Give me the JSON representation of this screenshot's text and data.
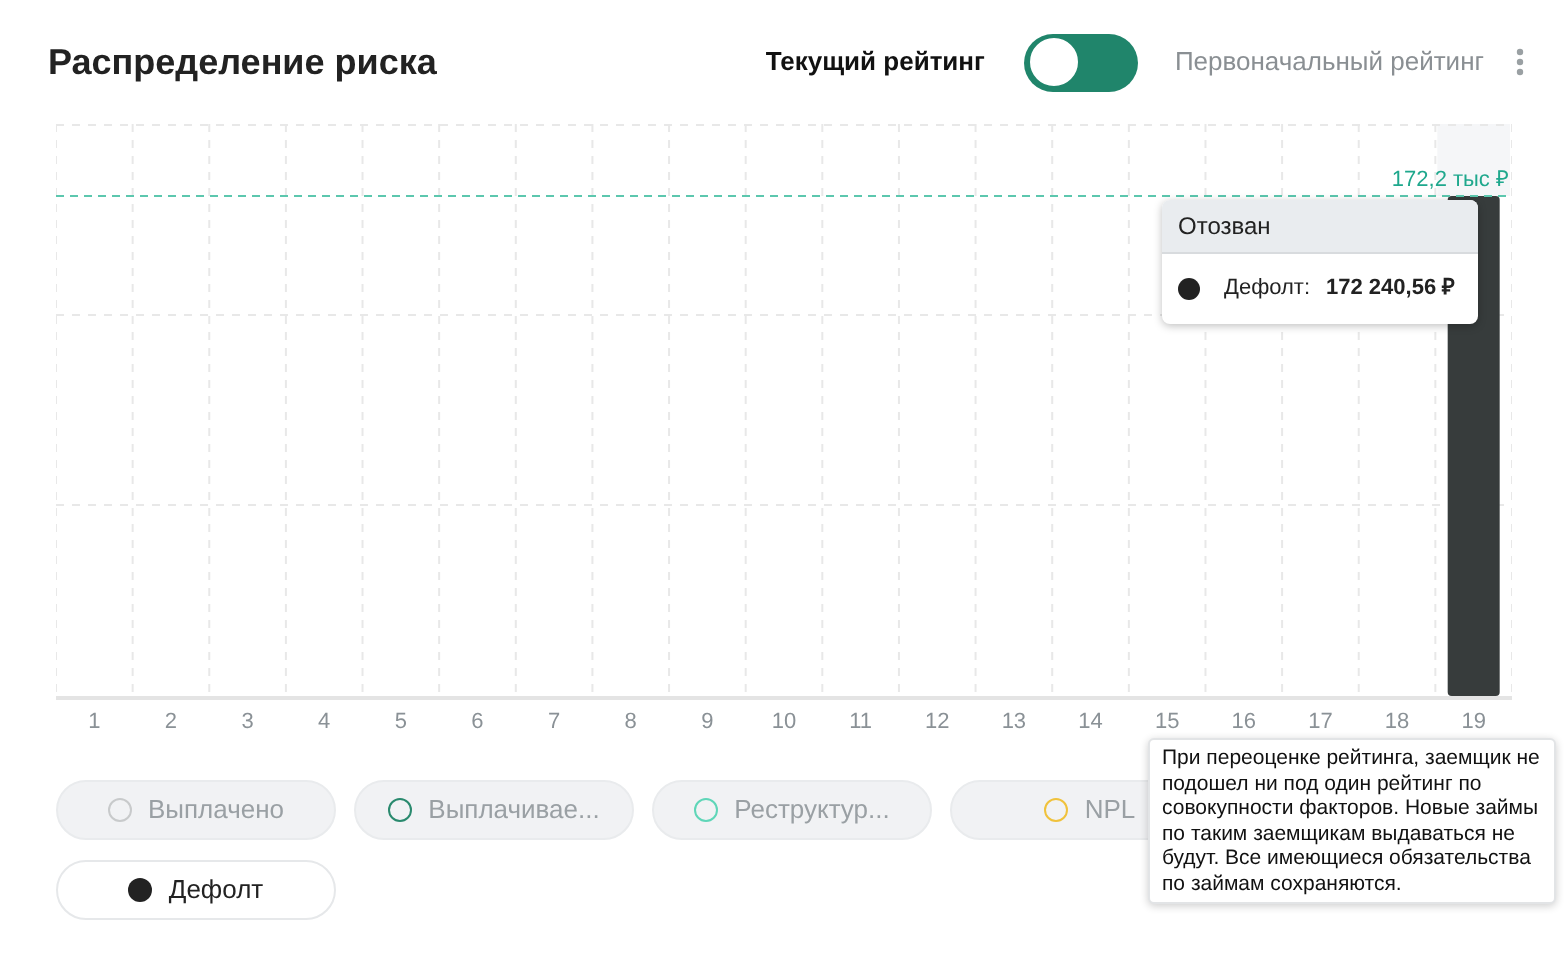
{
  "title": "Распределение риска",
  "ratings": [
    {
      "label": "Текущий рейтинг",
      "selected": true
    },
    {
      "label": "Первоначальный рейтинг",
      "selected": false
    }
  ],
  "chart": {
    "x_labels": [
      "1",
      "2",
      "3",
      "4",
      "5",
      "6",
      "7",
      "8",
      "9",
      "10",
      "11",
      "12",
      "13",
      "14",
      "15",
      "16",
      "17",
      "18",
      "19"
    ],
    "reference_label": "172,2 тыс ₽"
  },
  "bar_tooltip": {
    "header": "Отозван",
    "series": "Дефолт:",
    "value": "172 240,56 ₽",
    "color": "#222222"
  },
  "legend": [
    {
      "label": "Выплачено",
      "color": "#c8cacb",
      "selected": false
    },
    {
      "label": "Выплачивае...",
      "color": "#2a8a6e",
      "selected": false
    },
    {
      "label": "Реструктур...",
      "color": "#5fd6b8",
      "selected": false
    },
    {
      "label": "NPL",
      "color": "#f0c23c",
      "selected": false
    },
    {
      "label": "Дефолт",
      "color": "#222222",
      "selected": true
    }
  ],
  "hint_tooltip": "При переоценке рейтинга, заемщик не подошел ни под один рейтинг по совокупности факторов. Новые займы по таким заемщикам выдаваться не будут. Все имеющиеся обязательства по займам сохраняются."
}
